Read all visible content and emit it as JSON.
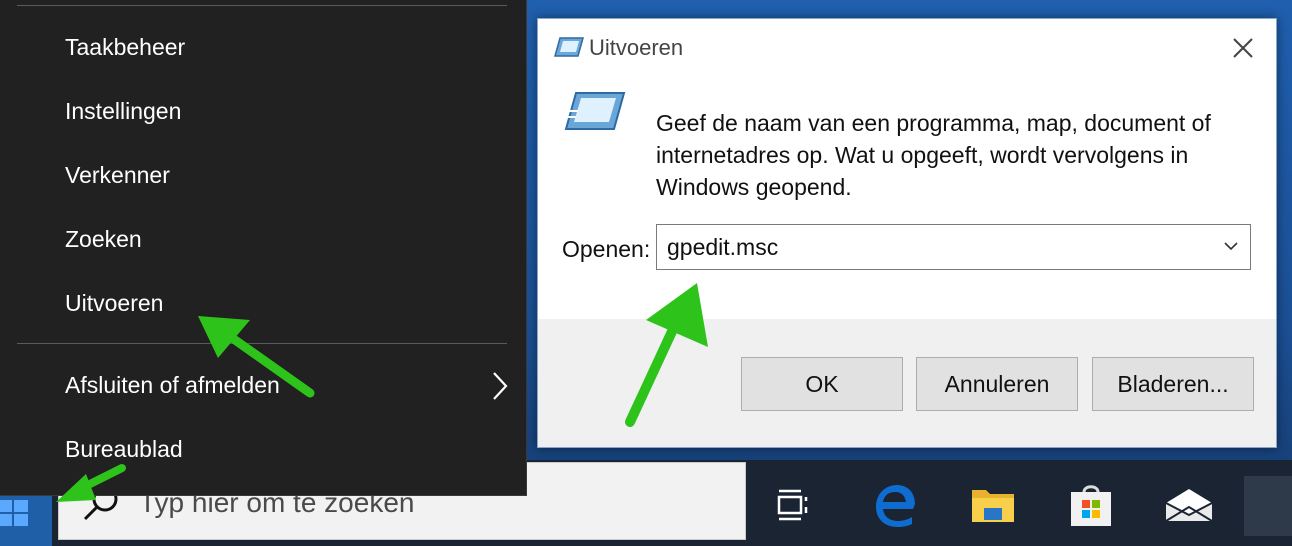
{
  "winx_menu": {
    "items": [
      {
        "label": "Taakbeheer"
      },
      {
        "label": "Instellingen"
      },
      {
        "label": "Verkenner"
      },
      {
        "label": "Zoeken"
      },
      {
        "label": "Uitvoeren"
      },
      {
        "label": "Afsluiten of afmelden"
      },
      {
        "label": "Bureaublad"
      }
    ]
  },
  "run_dialog": {
    "title": "Uitvoeren",
    "description": "Geef de naam van een programma, map, document of internetadres op. Wat u opgeeft, wordt vervolgens in Windows geopend.",
    "open_label": "Openen:",
    "open_value": "gpedit.msc",
    "buttons": {
      "ok": "OK",
      "cancel": "Annuleren",
      "browse": "Bladeren..."
    }
  },
  "taskbar": {
    "search_placeholder": "Typ hier om te zoeken"
  },
  "colors": {
    "annotation_arrow": "#2ec31a",
    "menu_bg": "#212121",
    "taskbar_bg": "#1a2432",
    "edge_blue": "#0f6cd0"
  },
  "icons": [
    "run-icon",
    "close-icon",
    "chevron-down-icon",
    "chevron-right-icon",
    "windows-logo-icon",
    "search-icon",
    "task-view-icon",
    "edge-icon",
    "file-explorer-icon",
    "store-icon",
    "mail-icon"
  ]
}
